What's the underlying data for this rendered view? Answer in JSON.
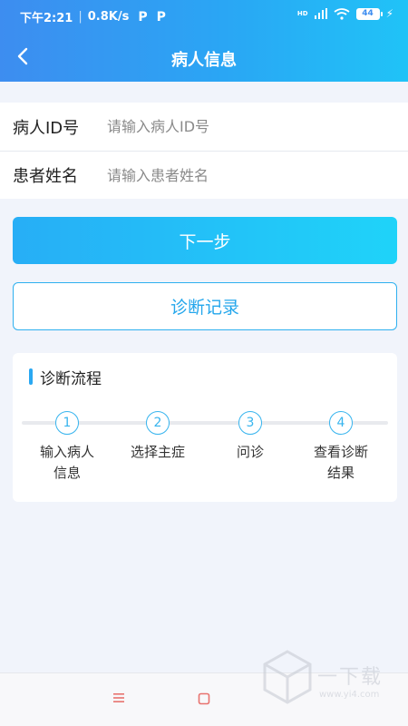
{
  "status_bar": {
    "time": "下午2:21",
    "speed": "0.8K/s",
    "p_icon_label": "P",
    "signal_label": "HD",
    "battery": "44"
  },
  "header": {
    "title": "病人信息"
  },
  "form": {
    "patient_id": {
      "label": "病人ID号",
      "placeholder": "请输入病人ID号",
      "value": ""
    },
    "patient_name": {
      "label": "患者姓名",
      "placeholder": "请输入患者姓名",
      "value": ""
    }
  },
  "buttons": {
    "next": "下一步",
    "records": "诊断记录"
  },
  "flow": {
    "title": "诊断流程",
    "steps": [
      {
        "num": "1",
        "label": "输入病人信息"
      },
      {
        "num": "2",
        "label": "选择主症"
      },
      {
        "num": "3",
        "label": "问诊"
      },
      {
        "num": "4",
        "label": "查看诊断结果"
      }
    ]
  },
  "watermark": {
    "text": "一下载",
    "url": "www.yi4.com"
  },
  "colors": {
    "accent": "#2aa8f2",
    "header_start": "#3d8df0",
    "header_end": "#20c3f7"
  }
}
